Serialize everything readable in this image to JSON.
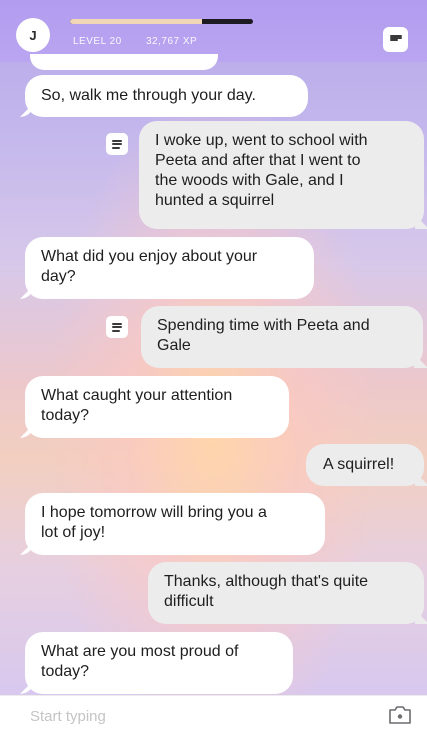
{
  "header": {
    "avatar_initial": "J",
    "level_label": "LEVEL 20",
    "xp_label": "32,767 XP",
    "xp_progress": 0.72
  },
  "messages": [
    {
      "sender": "bot",
      "text": "So, walk me through your day."
    },
    {
      "sender": "user",
      "lines": [
        "I woke up, went to school with",
        "Peeta and after that I went to",
        "the woods with Gale, and I",
        "hunted a squirrel"
      ],
      "has_note_icon": true
    },
    {
      "sender": "bot",
      "lines": [
        "What did you enjoy about your",
        "day?"
      ]
    },
    {
      "sender": "user",
      "lines": [
        "Spending time with Peeta and",
        "Gale"
      ],
      "has_note_icon": true
    },
    {
      "sender": "bot",
      "lines": [
        "What caught your attention",
        "today?"
      ]
    },
    {
      "sender": "user",
      "text": "A squirrel!"
    },
    {
      "sender": "bot",
      "lines": [
        "I hope tomorrow will bring you a",
        "lot of joy!"
      ]
    },
    {
      "sender": "user",
      "lines": [
        "Thanks, although that's quite",
        "difficult"
      ]
    },
    {
      "sender": "bot",
      "lines": [
        "What are you most proud of",
        "today?"
      ]
    }
  ],
  "composer": {
    "placeholder": "Start typing"
  },
  "icons": {
    "menu": "menu-lines-icon",
    "note": "note-lines-icon",
    "camera": "camera-icon"
  }
}
